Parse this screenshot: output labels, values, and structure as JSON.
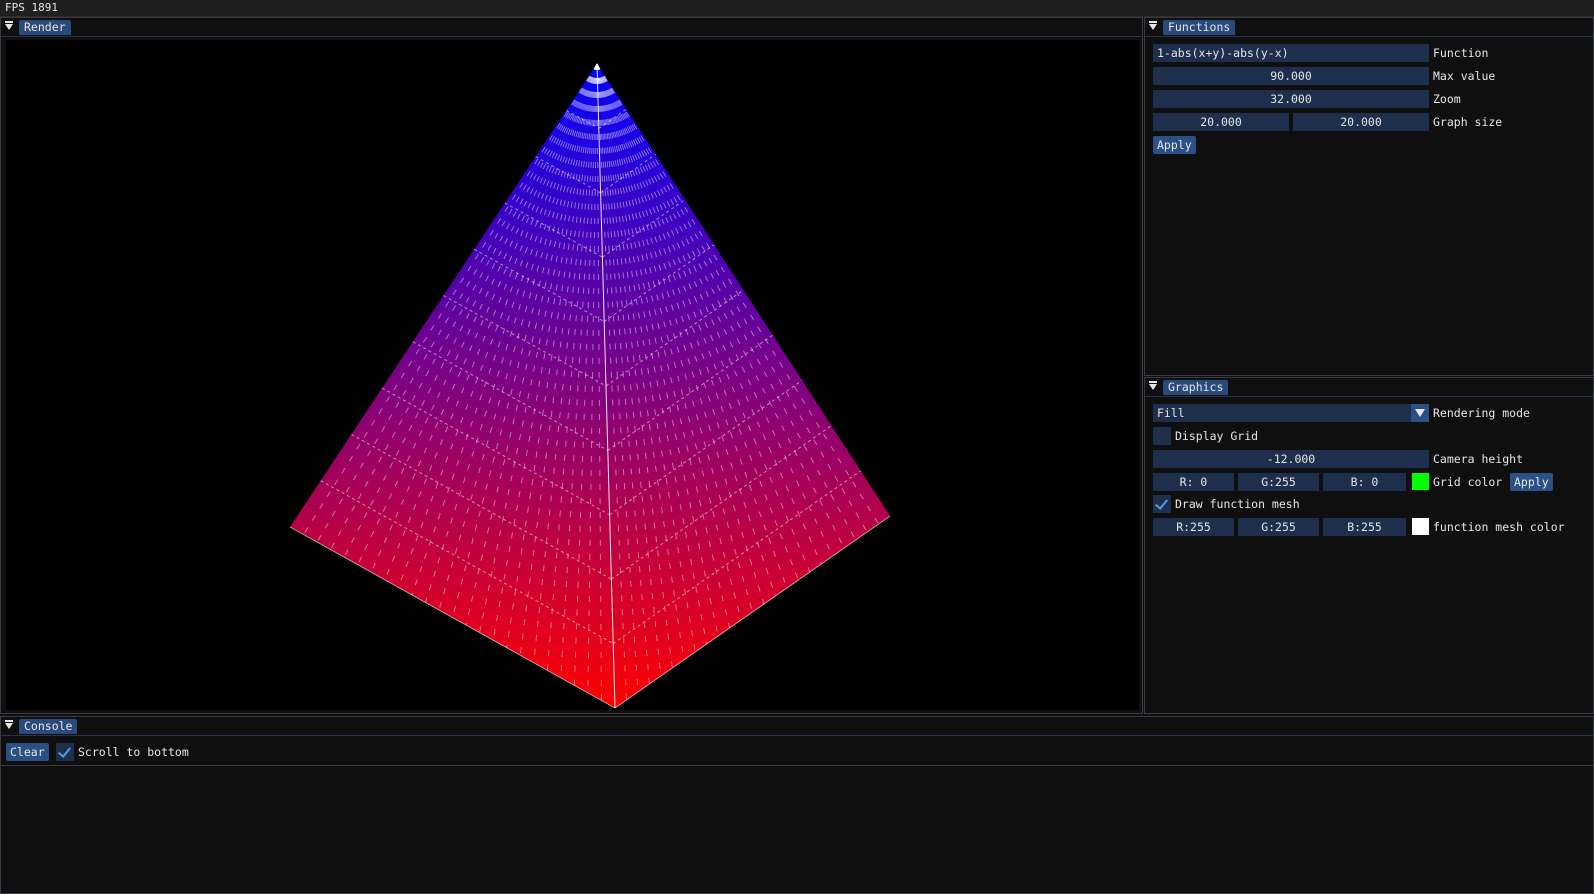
{
  "fps": "FPS 1891",
  "render_window": {
    "title": "Render"
  },
  "functions_window": {
    "title": "Functions",
    "function_value": "1-abs(x+y)-abs(y-x)",
    "function_label": "Function",
    "max_value": "90.000",
    "max_value_label": "Max value",
    "zoom": "32.000",
    "zoom_label": "Zoom",
    "graph_size_x": "20.000",
    "graph_size_y": "20.000",
    "graph_size_label": "Graph size",
    "apply_label": "Apply"
  },
  "graphics_window": {
    "title": "Graphics",
    "rendering_mode": "Fill",
    "rendering_mode_label": "Rendering mode",
    "display_grid_label": "Display Grid",
    "display_grid_checked": false,
    "camera_height": "-12.000",
    "camera_height_label": "Camera height",
    "grid_r": "R:  0",
    "grid_g": "G:255",
    "grid_b": "B:  0",
    "grid_color_label": "Grid color",
    "grid_color": "#00ff00",
    "apply_label": "Apply",
    "draw_mesh_label": "Draw function mesh",
    "draw_mesh_checked": true,
    "mesh_r": "R:255",
    "mesh_g": "G:255",
    "mesh_b": "B:255",
    "mesh_color_label": "function mesh color",
    "mesh_color": "#ffffff"
  },
  "console_window": {
    "title": "Console",
    "clear_label": "Clear",
    "scroll_label": "Scroll to bottom",
    "scroll_checked": true
  },
  "colors": {
    "surface_top": "#0000ff",
    "surface_bottom": "#ff0000",
    "accent": "#2b5085",
    "frame_bg": "#1d2f4d"
  }
}
